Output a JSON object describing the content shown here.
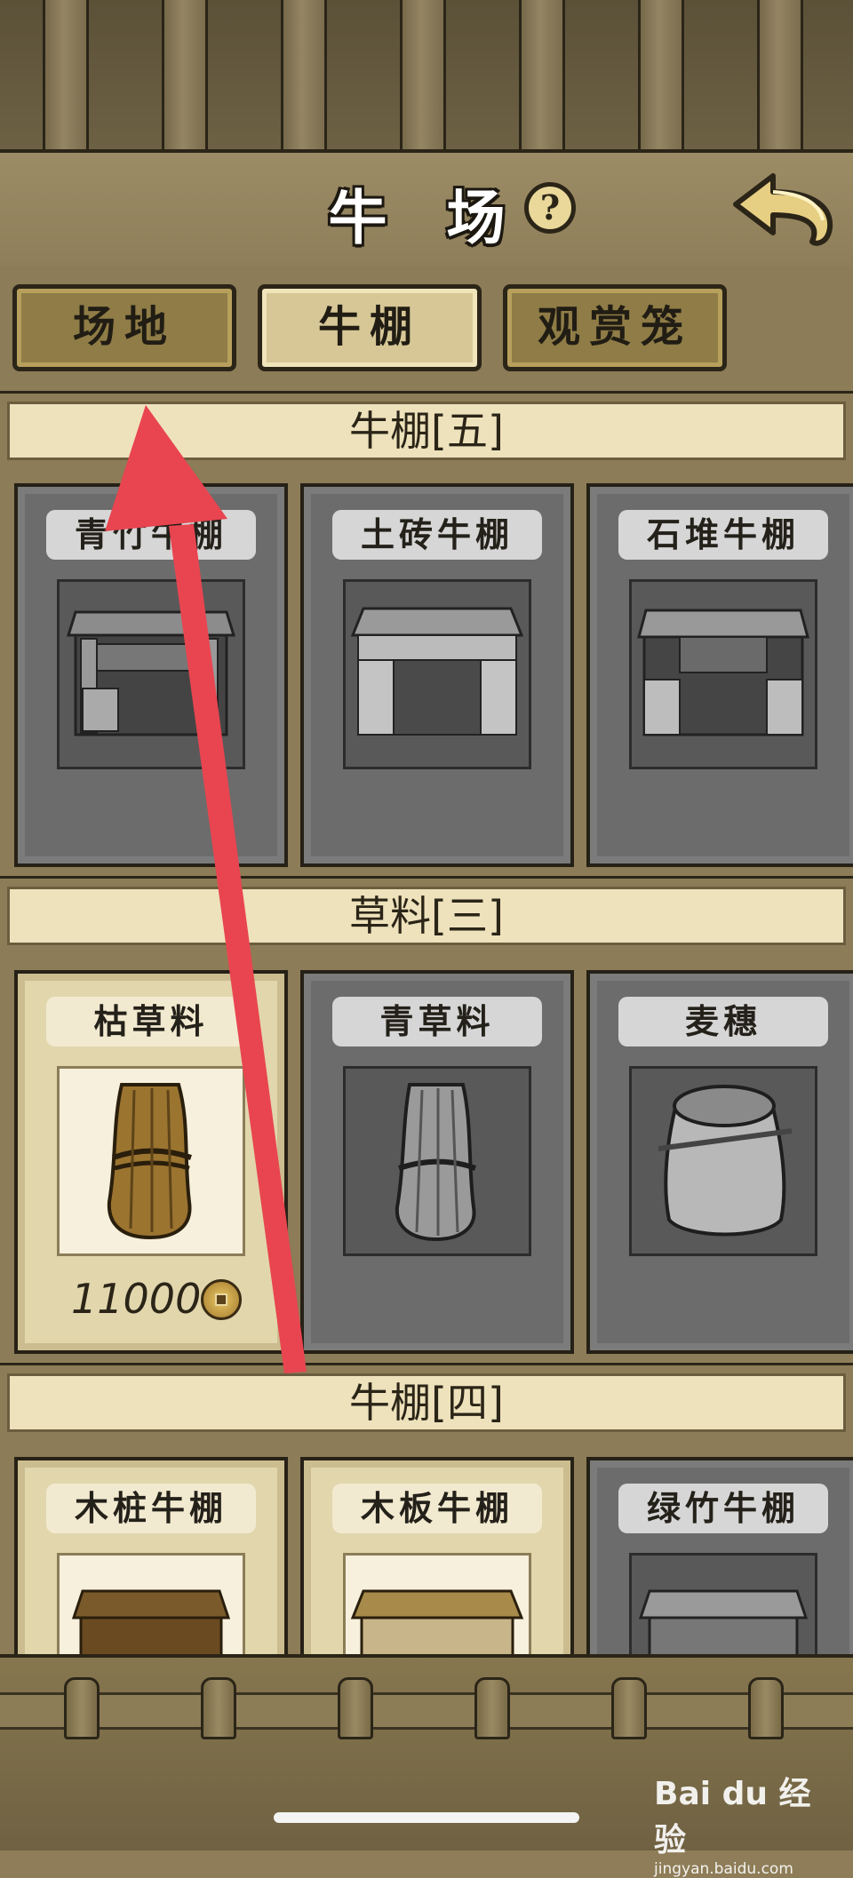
{
  "header": {
    "title": "牛 场",
    "help_label": "?"
  },
  "tabs": [
    {
      "label": "场地"
    },
    {
      "label": "牛棚"
    },
    {
      "label": "观赏笼"
    }
  ],
  "sections": [
    {
      "title": "牛棚[五]",
      "items": [
        {
          "label": "青竹牛棚",
          "state": "locked"
        },
        {
          "label": "土砖牛棚",
          "state": "locked"
        },
        {
          "label": "石堆牛棚",
          "state": "locked"
        }
      ]
    },
    {
      "title": "草料[三]",
      "items": [
        {
          "label": "枯草料",
          "state": "owned",
          "price": "11000"
        },
        {
          "label": "青草料",
          "state": "locked"
        },
        {
          "label": "麦穗",
          "state": "locked"
        }
      ]
    },
    {
      "title": "牛棚[四]",
      "items": [
        {
          "label": "木桩牛棚",
          "state": "owned"
        },
        {
          "label": "木板牛棚",
          "state": "owned"
        },
        {
          "label": "绿竹牛棚",
          "state": "locked"
        }
      ]
    }
  ],
  "watermark": {
    "main": "Bai du 经验",
    "url": "jingyan.baidu.com"
  },
  "colors": {
    "wood": "#8c7c57",
    "annotation_arrow": "#e84550",
    "locked_card": "#6c6c6c",
    "owned_card": "#e2d6ad"
  }
}
